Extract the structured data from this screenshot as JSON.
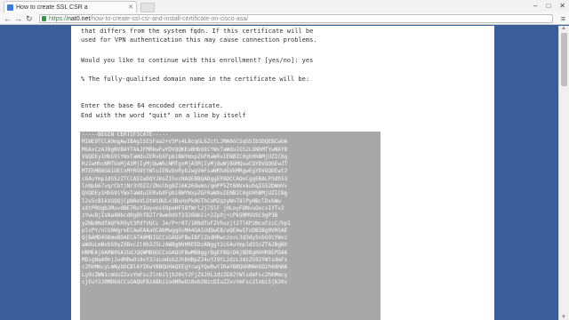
{
  "browser": {
    "tab_title": "How to create SSL CSR a",
    "url_scheme": "https://",
    "url_host": "nat0.net",
    "url_path": "/how-to-create-ssl-csr-and-install-certificate-on-cisco-asa/"
  },
  "article": {
    "line1": "that differs from the system fqdn. If this certificate will be",
    "line2": "used for VPN authentication this may cause connection problems.",
    "prompt": "Would you like to continue with this enrollment? [yes/no]: yes",
    "fqdn_note": "% The fully-qualified domain name in the certificate will be:",
    "enter_base64": "Enter the base 64 encoded certificate.",
    "end_with": "End with the word \"quit\" on a line by itself",
    "cert_begin": "-----BEGIN CERTIFICATE-----",
    "cert_lines": [
      "MIWE9TCCA9mgAwIBAgISESFaa2+V3Pv4L8cqGL6ZctLJMA0GCSqGSIb3DQEBCwUA",
      "MGAxCzAJBgNVBAYTAkJFMRkwFwYDVQQKExBHbG9iYWxTaWduIG52LXNhMTYwNAYD",
      "VQQDEy1HbG9iYWxTaWduIERvbXFpbiBWYWxpZGF0aW9uIENBIC0gU0hBMjUZICBg",
      "RzIwHhcNMTUxMjA3MjIyMjQwWhcNMTgxMjA3MjIyMjQwWjBGMQswCQYDVQQGEwJT",
      "MTEhMB8GA1UECxMYRG9tYWluIENvbnRyb2wgVmFsaWRhdGVkMRgwEgYDVQQDEwt2",
      "cG4uYmp1dS5zZTCCASIwDQYJKoZIhvcNAQEBBQADggEPADCCAQoCggEBALP3dh53",
      "lnNpb67vqrCbtjNr3YDZZ/ZNslbg8ZimK26dwmn/qmPP5Zt6NVxkuhqIG52DWmVv",
      "QVQDEy1HbG9iYWxTaWduIERvbXFpbiBWYWxpZGF0aW9uIENBIC0gU0hBMjUZICBg",
      "l2v5cB1kXGQQjCpN0eVLOtWtBULx3BxHnPk0GThCoMZqzyWnT8lPyHBclDxkWw",
      "sXtPRUgb2MuvdBE7RxYImyvmi69peHF58fWrlJj7SlF jHLoyFDNvuOxcvIYTv2",
      "zYwuBjIsNa4Hbcd0g8hfB2Tr9wm0dVf3326Nm1i+2Zp0j+cPk5MMVUSC9gP3B",
      "yZNb8NdfAQFKR9yt3PdfVUCL Je/P+r07/1RNdfuFZVhuzjt27l6P2NcxFzcC/hpI",
      "plcPY/nCG0WgreECAwEAAaOCAbMwggGvMA4GA1UdDwEB/wQEAwIFoDB3BgNVHSAE",
      "QjBAMD4GBmeBDAECATA0MDIGCCsGAQUFBwIBFiZodHRwczovL3d3dy5nbG9iYWxz",
      "aWduLmNvbS9yZXBvc2l0b3J5LzAWBgNVHREEDzANggt2cG4uYmp1dS5zZTAJBgNV",
      "HRMEAjAAMB0GA1UdJQQWMBQGCCsGAQUFBwMBBggrBgEFBQcDAjBDBgNVHR8EPDA6",
      "MDigNqA0hjJodHRwOi8vY3JsLmdsb2JhbHNpZ24uY29tL2dzL2dzZG92YWlsdmFs",
      "c2hhMmcyLmNybDCBlAYIKwYBBQUHAQEEgYcwgYQwRwYIKwYBBQUHMAKGO2h0dHA6",
      "Ly9zZWN1cmUuZ2xvYmFsc2lnbi5jb20vY2FjZXJ0L2dzZG92YWlsdmFsc2hhMmcy",
      "cjEuY3J0MDkGCCsGAQUFBzABhi1odHRwOi8vb2NzcDIuZ2xvYmFsc2lnbi5jb20v"
    ]
  }
}
